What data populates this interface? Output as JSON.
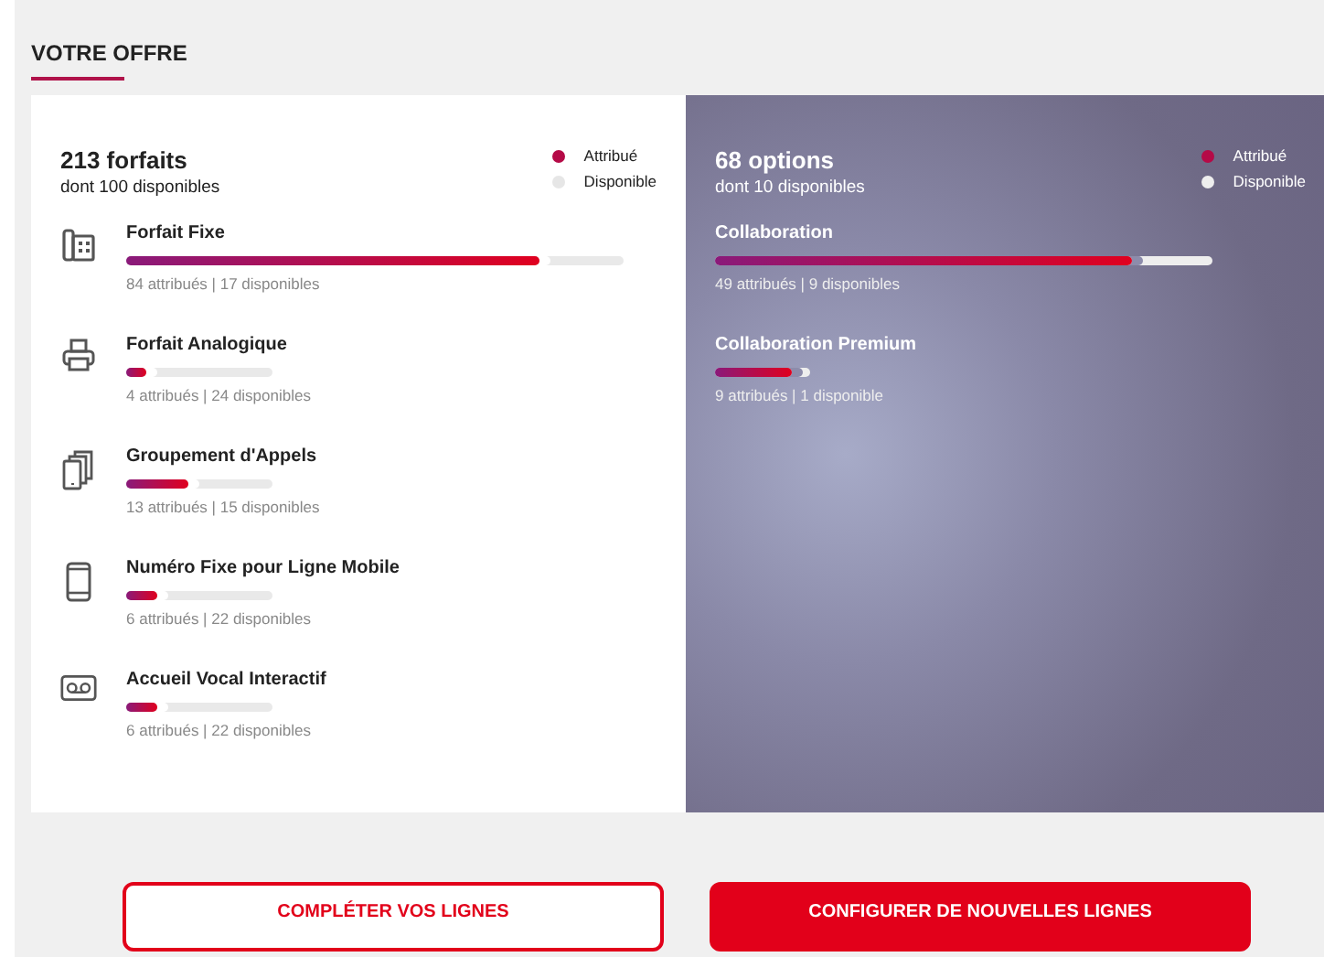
{
  "section_title": "VOTRE OFFRE",
  "plans": {
    "title": "213 forfaits",
    "subtitle": "dont 100 disponibles",
    "legend": [
      "Attribué",
      "Disponible"
    ],
    "items": [
      {
        "kind": "desk-phone",
        "name": "Forfait Fixe",
        "bar": {
          "kind": "long",
          "level": 0.83
        },
        "detail": "84 attribués | 17 disponibles"
      },
      {
        "kind": "printer",
        "name": "Forfait Analogique",
        "bar": {
          "kind": "short",
          "level": 0.14
        },
        "detail": "4 attribués | 24 disponibles"
      },
      {
        "kind": "stacked-phones",
        "name": "Groupement d'Appels",
        "bar": {
          "kind": "short",
          "level": 0.43
        },
        "detail": "13 attribués | 15 disponibles"
      },
      {
        "kind": "mobile",
        "name": "Numéro Fixe pour Ligne Mobile",
        "bar": {
          "kind": "short",
          "level": 0.21
        },
        "detail": "6 attribués | 22 disponibles"
      },
      {
        "kind": "voicemail",
        "name": "Accueil Vocal Interactif",
        "bar": {
          "kind": "short",
          "level": 0.21
        },
        "detail": "6 attribués | 22 disponibles"
      }
    ]
  },
  "options": {
    "title": "68 options",
    "subtitle": "dont 10 disponibles",
    "legend": [
      "Attribué",
      "Disponible"
    ],
    "items": [
      {
        "name": "Collaboration",
        "bar": {
          "kind": "long",
          "level": 0.84
        },
        "detail": "49 attribués | 9 disponibles"
      },
      {
        "name": "Collaboration Premium",
        "bar": {
          "kind": "tiny",
          "level": 0.8
        },
        "detail": "9 attribués | 1 disponible"
      }
    ]
  },
  "buttons": [
    {
      "label": "COMPLÉTER VOS LIGNES",
      "kind": "outline"
    },
    {
      "label": "CONFIGURER DE NOUVELLES LIGNES",
      "kind": "filled"
    }
  ]
}
